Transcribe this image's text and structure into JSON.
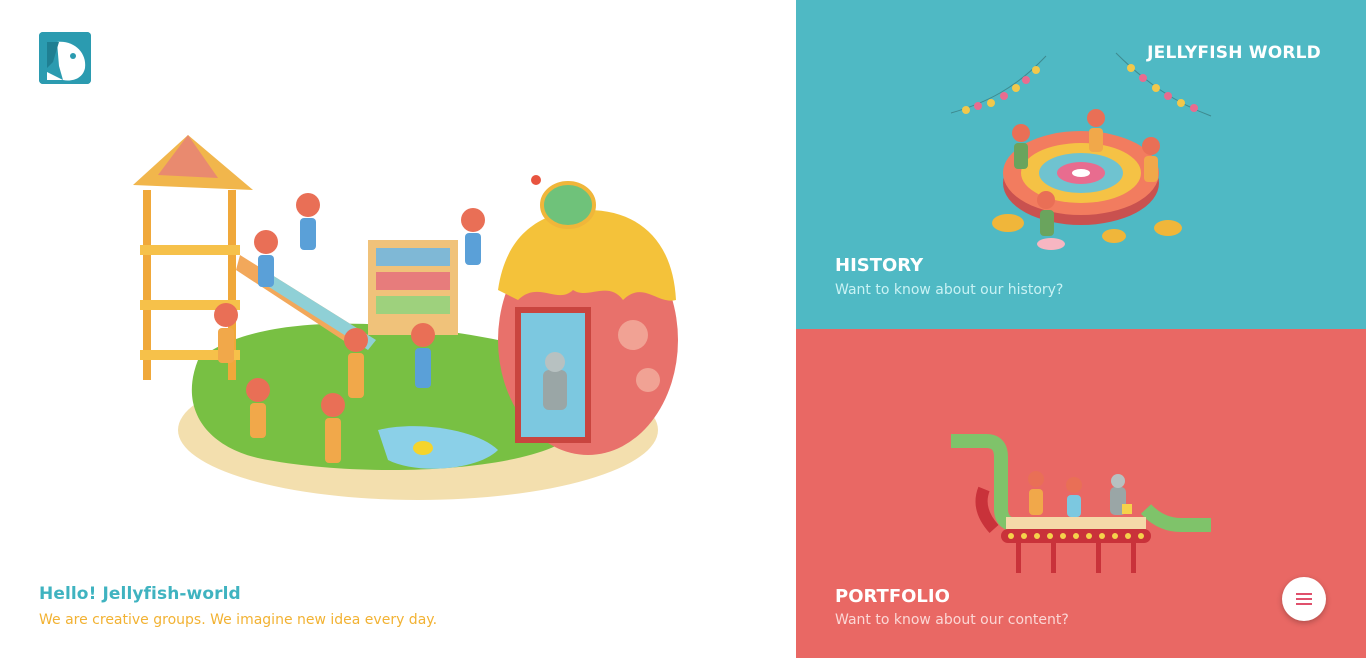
{
  "brand": {
    "name": "JELLYFISH WORLD",
    "logo_icon": "fish-head-logo-icon",
    "logo_color": "#2b9bb0"
  },
  "intro": {
    "title": "Hello! Jellyfish-world",
    "subtitle": "We are creative groups. We imagine new idea every day.",
    "title_color": "#3fb3c0",
    "subtitle_color": "#f2b233"
  },
  "hero": {
    "illustration": "playground-illustration"
  },
  "panels": [
    {
      "id": "history",
      "title": "HISTORY",
      "subtitle": "Want to know about our history?",
      "background": "#4fb9c4",
      "illustration": "candy-table-party-illustration"
    },
    {
      "id": "portfolio",
      "title": "PORTFOLIO",
      "subtitle": "Want to know about our content?",
      "background": "#e96864",
      "illustration": "conveyor-belt-illustration"
    }
  ],
  "menu": {
    "icon": "hamburger-menu-icon",
    "icon_color": "#e0506c"
  }
}
